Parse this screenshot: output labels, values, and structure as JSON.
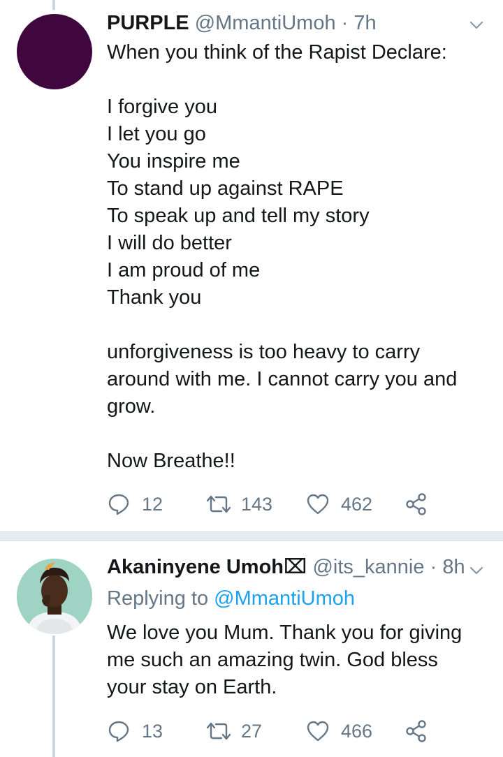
{
  "tweets": [
    {
      "name": "PURPLE",
      "handle": "@MmantiUmoh",
      "dot": "·",
      "time": "7h",
      "text_lines": [
        "When you think of the Rapist Declare:",
        "",
        "I forgive you",
        "I let you go",
        "You inspire me",
        "To stand up against RAPE",
        "To speak up and tell my story",
        "I will do better",
        "I am proud of me",
        "Thank you",
        "",
        "unforgiveness is too heavy to carry",
        "around with me. I cannot carry you and",
        "grow.",
        "",
        "Now Breathe!!"
      ],
      "replies": "12",
      "retweets": "143",
      "likes": "462",
      "avatar_color": "#40073f"
    },
    {
      "name": "Akaninyene Umoh⌧",
      "handle": "@its_kannie",
      "dot": "·",
      "time": "8h",
      "replying_prefix": "Replying to",
      "replying_to": "@MmantiUmoh",
      "text_lines": [
        "We love you Mum. Thank you for giving",
        "me such an amazing twin. God bless",
        "your stay on Earth."
      ],
      "replies": "13",
      "retweets": "27",
      "likes": "466"
    }
  ],
  "colors": {
    "text": "#14171a",
    "secondary": "#657786",
    "link": "#1da1f2",
    "divider": "#e6ecf0",
    "thread_line": "#ccd6dd"
  },
  "icons": [
    "chevron-down-icon",
    "reply-icon",
    "retweet-icon",
    "like-icon",
    "share-icon"
  ]
}
